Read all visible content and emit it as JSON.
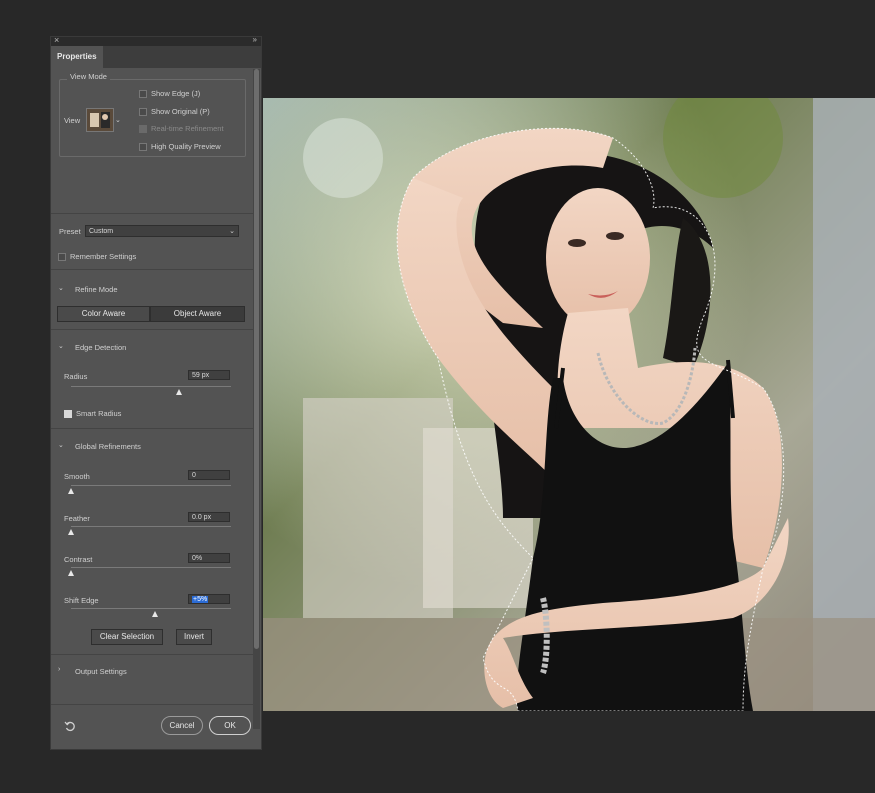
{
  "panel": {
    "tab_label": "Properties",
    "close_glyph": "×",
    "collapse_glyph": "»",
    "view_mode": {
      "title": "View Mode",
      "view_label": "View",
      "options": [
        {
          "label": "Show Edge (J)",
          "checked": false,
          "enabled": true
        },
        {
          "label": "Show Original (P)",
          "checked": false,
          "enabled": true
        },
        {
          "label": "Real-time Refinement",
          "checked": true,
          "enabled": false
        },
        {
          "label": "High Quality Preview",
          "checked": false,
          "enabled": true
        }
      ]
    },
    "preset": {
      "label": "Preset",
      "value": "Custom"
    },
    "remember_settings": {
      "label": "Remember Settings",
      "checked": false
    },
    "refine_mode": {
      "title": "Refine Mode",
      "color_aware": "Color Aware",
      "object_aware": "Object Aware",
      "selected": "Object Aware"
    },
    "edge_detection": {
      "title": "Edge Detection",
      "radius_label": "Radius",
      "radius_value": "59 px",
      "radius_fraction": 0.68,
      "smart_radius_label": "Smart Radius",
      "smart_radius_checked": true
    },
    "global_refinements": {
      "title": "Global Refinements",
      "smooth_label": "Smooth",
      "smooth_value": "0",
      "smooth_fraction": 0.0,
      "feather_label": "Feather",
      "feather_value": "0.0 px",
      "feather_fraction": 0.0,
      "contrast_label": "Contrast",
      "contrast_value": "0%",
      "contrast_fraction": 0.0,
      "shift_label": "Shift Edge",
      "shift_value": "+5%",
      "shift_fraction": 0.53
    },
    "clear_selection": "Clear Selection",
    "invert": "Invert",
    "output_settings": {
      "title": "Output Settings"
    },
    "cancel": "Cancel",
    "ok": "OK"
  },
  "colors": {
    "panel_bg": "#535353",
    "app_bg": "#282828",
    "highlight": "#2c6cd5"
  },
  "icons": {
    "reset": "reset-icon",
    "chevron_down": "chevron-down-icon",
    "chevron_right": "chevron-right-icon"
  }
}
